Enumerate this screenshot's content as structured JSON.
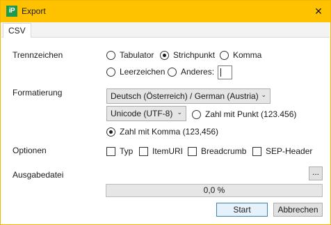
{
  "window": {
    "title": "Export",
    "logo_text": "iP",
    "close_glyph": "✕",
    "accent_color": "#ffc200",
    "logo_color": "#1e9a4d"
  },
  "tabs": [
    {
      "label": "CSV",
      "selected": true
    }
  ],
  "separator": {
    "label": "Trennzeichen",
    "options": [
      {
        "label": "Tabulator",
        "checked": false
      },
      {
        "label": "Strichpunkt",
        "checked": true
      },
      {
        "label": "Komma",
        "checked": false
      },
      {
        "label": "Leerzeichen",
        "checked": false
      },
      {
        "label": "Anderes:",
        "checked": false
      }
    ],
    "other_value": ""
  },
  "format": {
    "label": "Formatierung",
    "locale_selected": "Deutsch (Österreich) / German (Austria)",
    "encoding_selected": "Unicode (UTF-8)",
    "number_options": [
      {
        "label": "Zahl mit Punkt (123.456)",
        "checked": false
      },
      {
        "label": "Zahl mit Komma (123,456)",
        "checked": true
      }
    ]
  },
  "options": {
    "label": "Optionen",
    "items": [
      {
        "label": "Typ",
        "checked": false
      },
      {
        "label": "ItemURI",
        "checked": false
      },
      {
        "label": "Breadcrumb",
        "checked": false
      },
      {
        "label": "SEP-Header",
        "checked": false
      }
    ]
  },
  "output": {
    "label": "Ausgabedatei",
    "browse_label": "...",
    "progress_text": "0,0 %",
    "progress_value": 0
  },
  "actions": {
    "start_label": "Start",
    "cancel_label": "Abbrechen"
  }
}
